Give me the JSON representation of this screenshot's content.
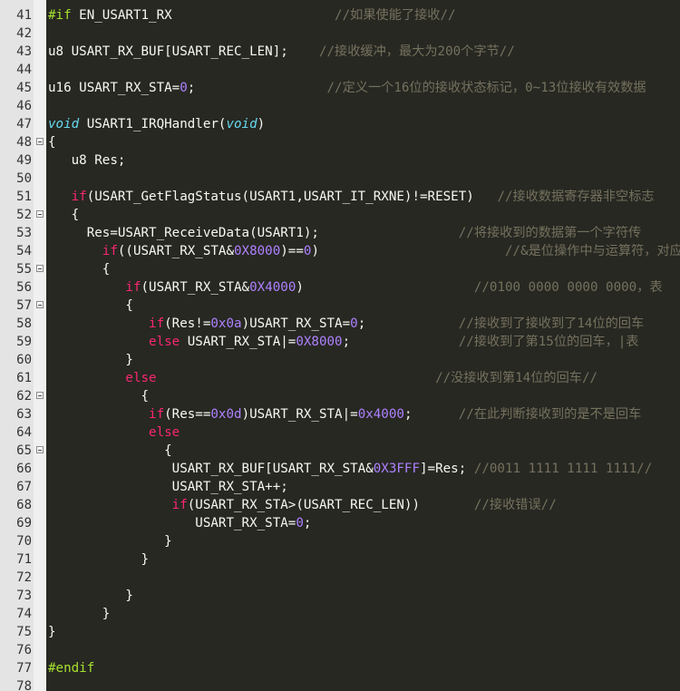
{
  "lines": [
    {
      "n": "41",
      "fold": false,
      "indent": "",
      "segs": [
        {
          "t": "pp",
          "v": "#if"
        },
        {
          "t": "id",
          "v": " EN_USART1_RX                     "
        },
        {
          "t": "cmt",
          "v": "//如果使能了接收//"
        }
      ]
    },
    {
      "n": "42",
      "fold": false,
      "indent": "",
      "segs": []
    },
    {
      "n": "43",
      "fold": false,
      "indent": "",
      "segs": [
        {
          "t": "id",
          "v": "u8 USART_RX_BUF[USART_REC_LEN];    "
        },
        {
          "t": "cmt",
          "v": "//接收缓冲，最大为200个字节//"
        }
      ]
    },
    {
      "n": "44",
      "fold": false,
      "indent": "",
      "segs": []
    },
    {
      "n": "45",
      "fold": false,
      "indent": "",
      "segs": [
        {
          "t": "id",
          "v": "u16 USART_RX_STA="
        },
        {
          "t": "num",
          "v": "0"
        },
        {
          "t": "id",
          "v": ";                 "
        },
        {
          "t": "cmt",
          "v": "//定义一个16位的接收状态标记，0~13位接收有效数据"
        }
      ]
    },
    {
      "n": "46",
      "fold": false,
      "indent": "",
      "segs": []
    },
    {
      "n": "47",
      "fold": false,
      "indent": "",
      "segs": [
        {
          "t": "type",
          "v": "void"
        },
        {
          "t": "id",
          "v": " USART1_IRQHandler("
        },
        {
          "t": "type",
          "v": "void"
        },
        {
          "t": "id",
          "v": ")"
        }
      ]
    },
    {
      "n": "48",
      "fold": true,
      "indent": "",
      "segs": [
        {
          "t": "id",
          "v": "{"
        }
      ]
    },
    {
      "n": "49",
      "fold": false,
      "indent": "   ",
      "segs": [
        {
          "t": "id",
          "v": "u8 Res;"
        }
      ]
    },
    {
      "n": "50",
      "fold": false,
      "indent": "",
      "segs": []
    },
    {
      "n": "51",
      "fold": false,
      "indent": "   ",
      "segs": [
        {
          "t": "kw",
          "v": "if"
        },
        {
          "t": "id",
          "v": "(USART_GetFlagStatus(USART1,USART_IT_RXNE)!=RESET)   "
        },
        {
          "t": "cmt",
          "v": "//接收数据寄存器非空标志"
        }
      ]
    },
    {
      "n": "52",
      "fold": true,
      "indent": "   ",
      "segs": [
        {
          "t": "id",
          "v": "{"
        }
      ]
    },
    {
      "n": "53",
      "fold": false,
      "indent": "     ",
      "segs": [
        {
          "t": "id",
          "v": "Res=USART_ReceiveData(USART1);                  "
        },
        {
          "t": "cmt",
          "v": "//将接收到的数据第一个字符传"
        }
      ]
    },
    {
      "n": "54",
      "fold": false,
      "indent": "       ",
      "segs": [
        {
          "t": "kw",
          "v": "if"
        },
        {
          "t": "id",
          "v": "((USART_RX_STA&"
        },
        {
          "t": "num",
          "v": "0X8000"
        },
        {
          "t": "id",
          "v": ")=="
        },
        {
          "t": "num",
          "v": "0"
        },
        {
          "t": "id",
          "v": ")                        "
        },
        {
          "t": "cmt",
          "v": "//&是位操作中与运算符，对应"
        }
      ]
    },
    {
      "n": "55",
      "fold": true,
      "indent": "       ",
      "segs": [
        {
          "t": "id",
          "v": "{"
        }
      ]
    },
    {
      "n": "56",
      "fold": false,
      "indent": "          ",
      "segs": [
        {
          "t": "kw",
          "v": "if"
        },
        {
          "t": "id",
          "v": "(USART_RX_STA&"
        },
        {
          "t": "num",
          "v": "0X4000"
        },
        {
          "t": "id",
          "v": ")                      "
        },
        {
          "t": "cmt",
          "v": "//0100 0000 0000 0000，表"
        }
      ]
    },
    {
      "n": "57",
      "fold": true,
      "indent": "          ",
      "segs": [
        {
          "t": "id",
          "v": "{"
        }
      ]
    },
    {
      "n": "58",
      "fold": false,
      "indent": "             ",
      "segs": [
        {
          "t": "kw",
          "v": "if"
        },
        {
          "t": "id",
          "v": "(Res!="
        },
        {
          "t": "num",
          "v": "0x0a"
        },
        {
          "t": "id",
          "v": ")USART_RX_STA="
        },
        {
          "t": "num",
          "v": "0"
        },
        {
          "t": "id",
          "v": ";            "
        },
        {
          "t": "cmt",
          "v": "//接收到了接收到了14位的回车"
        }
      ]
    },
    {
      "n": "59",
      "fold": false,
      "indent": "             ",
      "segs": [
        {
          "t": "kw",
          "v": "else"
        },
        {
          "t": "id",
          "v": " USART_RX_STA|="
        },
        {
          "t": "num",
          "v": "0X8000"
        },
        {
          "t": "id",
          "v": ";              "
        },
        {
          "t": "cmt",
          "v": "//接收到了第15位的回车，|表"
        }
      ]
    },
    {
      "n": "60",
      "fold": false,
      "indent": "          ",
      "segs": [
        {
          "t": "id",
          "v": "}"
        }
      ]
    },
    {
      "n": "61",
      "fold": false,
      "indent": "          ",
      "segs": [
        {
          "t": "kw",
          "v": "else"
        },
        {
          "t": "id",
          "v": "                                    "
        },
        {
          "t": "cmt",
          "v": "//没接收到第14位的回车//"
        }
      ]
    },
    {
      "n": "62",
      "fold": true,
      "indent": "            ",
      "segs": [
        {
          "t": "id",
          "v": "{"
        }
      ]
    },
    {
      "n": "63",
      "fold": false,
      "indent": "             ",
      "segs": [
        {
          "t": "kw",
          "v": "if"
        },
        {
          "t": "id",
          "v": "(Res=="
        },
        {
          "t": "num",
          "v": "0x0d"
        },
        {
          "t": "id",
          "v": ")USART_RX_STA|="
        },
        {
          "t": "num",
          "v": "0x4000"
        },
        {
          "t": "id",
          "v": ";      "
        },
        {
          "t": "cmt",
          "v": "//在此判断接收到的是不是回车"
        }
      ]
    },
    {
      "n": "64",
      "fold": false,
      "indent": "             ",
      "segs": [
        {
          "t": "kw",
          "v": "else"
        }
      ]
    },
    {
      "n": "65",
      "fold": true,
      "indent": "               ",
      "segs": [
        {
          "t": "id",
          "v": "{"
        }
      ]
    },
    {
      "n": "66",
      "fold": false,
      "indent": "                ",
      "segs": [
        {
          "t": "id",
          "v": "USART_RX_BUF[USART_RX_STA&"
        },
        {
          "t": "num",
          "v": "0X3FFF"
        },
        {
          "t": "id",
          "v": "]=Res; "
        },
        {
          "t": "cmt",
          "v": "//0011 1111 1111 1111//"
        }
      ]
    },
    {
      "n": "67",
      "fold": false,
      "indent": "                ",
      "segs": [
        {
          "t": "id",
          "v": "USART_RX_STA++;"
        }
      ]
    },
    {
      "n": "68",
      "fold": false,
      "indent": "                ",
      "segs": [
        {
          "t": "kw",
          "v": "if"
        },
        {
          "t": "id",
          "v": "(USART_RX_STA>(USART_REC_LEN))       "
        },
        {
          "t": "cmt",
          "v": "//接收错误//"
        }
      ]
    },
    {
      "n": "69",
      "fold": false,
      "indent": "                   ",
      "segs": [
        {
          "t": "id",
          "v": "USART_RX_STA="
        },
        {
          "t": "num",
          "v": "0"
        },
        {
          "t": "id",
          "v": ";"
        }
      ]
    },
    {
      "n": "70",
      "fold": false,
      "indent": "               ",
      "segs": [
        {
          "t": "id",
          "v": "}"
        }
      ]
    },
    {
      "n": "71",
      "fold": false,
      "indent": "            ",
      "segs": [
        {
          "t": "id",
          "v": "}"
        }
      ]
    },
    {
      "n": "72",
      "fold": false,
      "indent": "",
      "segs": []
    },
    {
      "n": "73",
      "fold": false,
      "indent": "          ",
      "segs": [
        {
          "t": "id",
          "v": "}"
        }
      ]
    },
    {
      "n": "74",
      "fold": false,
      "indent": "       ",
      "segs": [
        {
          "t": "id",
          "v": "}"
        }
      ]
    },
    {
      "n": "75",
      "fold": false,
      "indent": "",
      "segs": [
        {
          "t": "id",
          "v": "}"
        }
      ]
    },
    {
      "n": "76",
      "fold": false,
      "indent": "",
      "segs": []
    },
    {
      "n": "77",
      "fold": false,
      "indent": "",
      "segs": [
        {
          "t": "pp",
          "v": "#endif"
        }
      ]
    },
    {
      "n": "78",
      "fold": false,
      "indent": "",
      "segs": []
    }
  ]
}
